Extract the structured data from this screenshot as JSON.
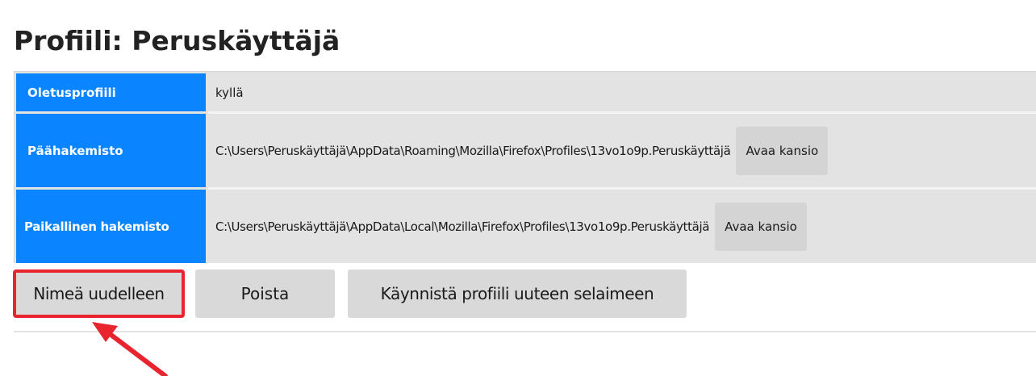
{
  "page": {
    "title": "Profiili: Peruskäyttäjä"
  },
  "profile_info": {
    "rows": [
      {
        "label": "Oletusprofiili",
        "value": "kyllä"
      },
      {
        "label": "Päähakemisto",
        "value": "C:\\Users\\Peruskäyttäjä\\AppData\\Roaming\\Mozilla\\Firefox\\Profiles\\13vo1o9p.Peruskäyttäjä",
        "button_label": "Avaa kansio"
      },
      {
        "label": "Paikallinen hakemisto",
        "value": "C:\\Users\\Peruskäyttäjä\\AppData\\Local\\Mozilla\\Firefox\\Profiles\\13vo1o9p.Peruskäyttäjä",
        "button_label": "Avaa kansio"
      }
    ]
  },
  "actions": {
    "rename_label": "Nimeä uudelleen",
    "delete_label": "Poista",
    "launch_label": "Käynnistä profiili uuteen selaimeen"
  },
  "colors": {
    "header_blue": "#0a84ff",
    "highlight_red": "#e8242f",
    "row_background": "#e3e3e3",
    "button_background": "#d9d9d9"
  },
  "annotations": {
    "highlight": "rename-button",
    "arrow_icon": "arrow-pointer-icon"
  }
}
